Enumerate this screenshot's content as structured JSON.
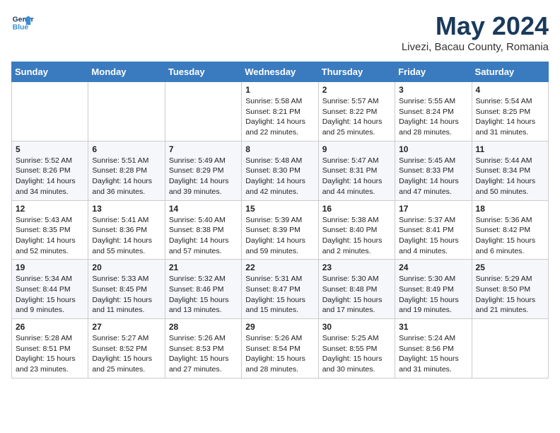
{
  "header": {
    "logo_line1": "General",
    "logo_line2": "Blue",
    "month": "May 2024",
    "location": "Livezi, Bacau County, Romania"
  },
  "weekdays": [
    "Sunday",
    "Monday",
    "Tuesday",
    "Wednesday",
    "Thursday",
    "Friday",
    "Saturday"
  ],
  "weeks": [
    [
      {
        "day": "",
        "sunrise": "",
        "sunset": "",
        "daylight": ""
      },
      {
        "day": "",
        "sunrise": "",
        "sunset": "",
        "daylight": ""
      },
      {
        "day": "",
        "sunrise": "",
        "sunset": "",
        "daylight": ""
      },
      {
        "day": "1",
        "sunrise": "Sunrise: 5:58 AM",
        "sunset": "Sunset: 8:21 PM",
        "daylight": "Daylight: 14 hours and 22 minutes."
      },
      {
        "day": "2",
        "sunrise": "Sunrise: 5:57 AM",
        "sunset": "Sunset: 8:22 PM",
        "daylight": "Daylight: 14 hours and 25 minutes."
      },
      {
        "day": "3",
        "sunrise": "Sunrise: 5:55 AM",
        "sunset": "Sunset: 8:24 PM",
        "daylight": "Daylight: 14 hours and 28 minutes."
      },
      {
        "day": "4",
        "sunrise": "Sunrise: 5:54 AM",
        "sunset": "Sunset: 8:25 PM",
        "daylight": "Daylight: 14 hours and 31 minutes."
      }
    ],
    [
      {
        "day": "5",
        "sunrise": "Sunrise: 5:52 AM",
        "sunset": "Sunset: 8:26 PM",
        "daylight": "Daylight: 14 hours and 34 minutes."
      },
      {
        "day": "6",
        "sunrise": "Sunrise: 5:51 AM",
        "sunset": "Sunset: 8:28 PM",
        "daylight": "Daylight: 14 hours and 36 minutes."
      },
      {
        "day": "7",
        "sunrise": "Sunrise: 5:49 AM",
        "sunset": "Sunset: 8:29 PM",
        "daylight": "Daylight: 14 hours and 39 minutes."
      },
      {
        "day": "8",
        "sunrise": "Sunrise: 5:48 AM",
        "sunset": "Sunset: 8:30 PM",
        "daylight": "Daylight: 14 hours and 42 minutes."
      },
      {
        "day": "9",
        "sunrise": "Sunrise: 5:47 AM",
        "sunset": "Sunset: 8:31 PM",
        "daylight": "Daylight: 14 hours and 44 minutes."
      },
      {
        "day": "10",
        "sunrise": "Sunrise: 5:45 AM",
        "sunset": "Sunset: 8:33 PM",
        "daylight": "Daylight: 14 hours and 47 minutes."
      },
      {
        "day": "11",
        "sunrise": "Sunrise: 5:44 AM",
        "sunset": "Sunset: 8:34 PM",
        "daylight": "Daylight: 14 hours and 50 minutes."
      }
    ],
    [
      {
        "day": "12",
        "sunrise": "Sunrise: 5:43 AM",
        "sunset": "Sunset: 8:35 PM",
        "daylight": "Daylight: 14 hours and 52 minutes."
      },
      {
        "day": "13",
        "sunrise": "Sunrise: 5:41 AM",
        "sunset": "Sunset: 8:36 PM",
        "daylight": "Daylight: 14 hours and 55 minutes."
      },
      {
        "day": "14",
        "sunrise": "Sunrise: 5:40 AM",
        "sunset": "Sunset: 8:38 PM",
        "daylight": "Daylight: 14 hours and 57 minutes."
      },
      {
        "day": "15",
        "sunrise": "Sunrise: 5:39 AM",
        "sunset": "Sunset: 8:39 PM",
        "daylight": "Daylight: 14 hours and 59 minutes."
      },
      {
        "day": "16",
        "sunrise": "Sunrise: 5:38 AM",
        "sunset": "Sunset: 8:40 PM",
        "daylight": "Daylight: 15 hours and 2 minutes."
      },
      {
        "day": "17",
        "sunrise": "Sunrise: 5:37 AM",
        "sunset": "Sunset: 8:41 PM",
        "daylight": "Daylight: 15 hours and 4 minutes."
      },
      {
        "day": "18",
        "sunrise": "Sunrise: 5:36 AM",
        "sunset": "Sunset: 8:42 PM",
        "daylight": "Daylight: 15 hours and 6 minutes."
      }
    ],
    [
      {
        "day": "19",
        "sunrise": "Sunrise: 5:34 AM",
        "sunset": "Sunset: 8:44 PM",
        "daylight": "Daylight: 15 hours and 9 minutes."
      },
      {
        "day": "20",
        "sunrise": "Sunrise: 5:33 AM",
        "sunset": "Sunset: 8:45 PM",
        "daylight": "Daylight: 15 hours and 11 minutes."
      },
      {
        "day": "21",
        "sunrise": "Sunrise: 5:32 AM",
        "sunset": "Sunset: 8:46 PM",
        "daylight": "Daylight: 15 hours and 13 minutes."
      },
      {
        "day": "22",
        "sunrise": "Sunrise: 5:31 AM",
        "sunset": "Sunset: 8:47 PM",
        "daylight": "Daylight: 15 hours and 15 minutes."
      },
      {
        "day": "23",
        "sunrise": "Sunrise: 5:30 AM",
        "sunset": "Sunset: 8:48 PM",
        "daylight": "Daylight: 15 hours and 17 minutes."
      },
      {
        "day": "24",
        "sunrise": "Sunrise: 5:30 AM",
        "sunset": "Sunset: 8:49 PM",
        "daylight": "Daylight: 15 hours and 19 minutes."
      },
      {
        "day": "25",
        "sunrise": "Sunrise: 5:29 AM",
        "sunset": "Sunset: 8:50 PM",
        "daylight": "Daylight: 15 hours and 21 minutes."
      }
    ],
    [
      {
        "day": "26",
        "sunrise": "Sunrise: 5:28 AM",
        "sunset": "Sunset: 8:51 PM",
        "daylight": "Daylight: 15 hours and 23 minutes."
      },
      {
        "day": "27",
        "sunrise": "Sunrise: 5:27 AM",
        "sunset": "Sunset: 8:52 PM",
        "daylight": "Daylight: 15 hours and 25 minutes."
      },
      {
        "day": "28",
        "sunrise": "Sunrise: 5:26 AM",
        "sunset": "Sunset: 8:53 PM",
        "daylight": "Daylight: 15 hours and 27 minutes."
      },
      {
        "day": "29",
        "sunrise": "Sunrise: 5:26 AM",
        "sunset": "Sunset: 8:54 PM",
        "daylight": "Daylight: 15 hours and 28 minutes."
      },
      {
        "day": "30",
        "sunrise": "Sunrise: 5:25 AM",
        "sunset": "Sunset: 8:55 PM",
        "daylight": "Daylight: 15 hours and 30 minutes."
      },
      {
        "day": "31",
        "sunrise": "Sunrise: 5:24 AM",
        "sunset": "Sunset: 8:56 PM",
        "daylight": "Daylight: 15 hours and 31 minutes."
      },
      {
        "day": "",
        "sunrise": "",
        "sunset": "",
        "daylight": ""
      }
    ]
  ]
}
